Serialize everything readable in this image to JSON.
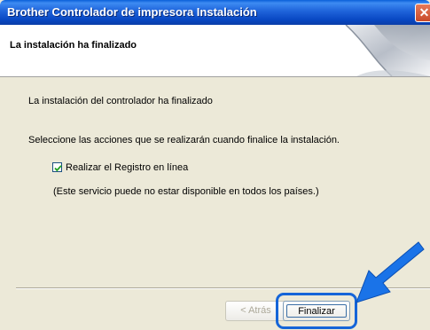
{
  "window": {
    "title": "Brother Controlador de impresora Instalación",
    "close_glyph": "✕"
  },
  "header": {
    "title": "La instalación ha finalizado"
  },
  "content": {
    "line1": "La instalación del controlador ha finalizado",
    "line2": "Seleccione las acciones que se realizarán cuando finalice la instalación.",
    "checkbox_label": "Realizar el Registro en línea",
    "checkbox_checked": true,
    "note": "(Este servicio puede no estar disponible en todos los países.)"
  },
  "buttons": {
    "back": "< Atrás",
    "finish": "Finalizar"
  },
  "colors": {
    "title_bar": "#0A5FD8",
    "highlight": "#1565D8",
    "arrow": "#1A73E8"
  },
  "icons": {
    "close": "close-icon",
    "check": "checkmark-icon",
    "arrow": "pointer-arrow-icon",
    "header_graphic": "page-curl-graphic-icon"
  }
}
